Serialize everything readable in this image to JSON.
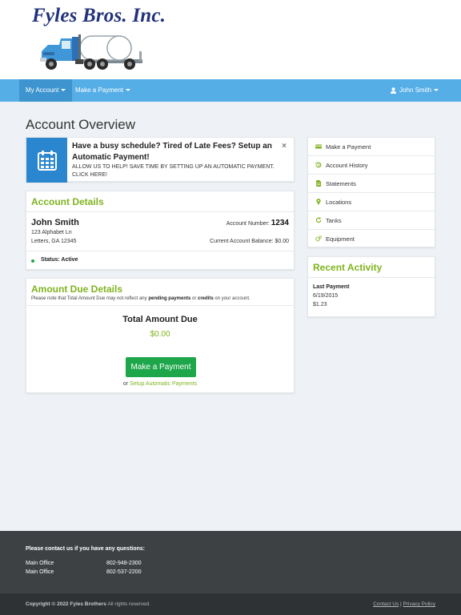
{
  "brand": {
    "name": "Fyles Bros. Inc."
  },
  "nav": {
    "my_account": "My Account",
    "make_payment": "Make a Payment",
    "user": "John Smith"
  },
  "page": {
    "title": "Account Overview"
  },
  "promo": {
    "title": "Have a busy schedule? Tired of Late Fees? Setup an Automatic Payment!",
    "body": "ALLOW US TO HELP! SAVE TIME BY SETTING UP AN AUTOMATIC PAYMENT. CLICK HERE!",
    "close": "×"
  },
  "account": {
    "title": "Account Details",
    "name": "John Smith",
    "address1": "123 Alphabet Ln",
    "address2": "Letters, GA 12345",
    "number_label": "Account Number:",
    "number": "1234",
    "balance": "Current Account Balance: $0.00",
    "status": "Status: Active"
  },
  "due": {
    "title": "Amount Due Details",
    "note_pre": "Please note that Total Amount Due may not reflect any ",
    "note_b1": "pending payments",
    "note_mid": " or ",
    "note_b2": "credits",
    "note_post": " on your account.",
    "label": "Total Amount Due",
    "amount": "$0.00",
    "button": "Make a Payment",
    "or": "or ",
    "setup_link": "Setup Automatic Payments"
  },
  "side_menu": {
    "items": [
      {
        "label": "Make a Payment",
        "icon": "credit-card-icon"
      },
      {
        "label": "Account History",
        "icon": "history-icon"
      },
      {
        "label": "Statements",
        "icon": "document-icon"
      },
      {
        "label": "Locations",
        "icon": "map-pin-icon"
      },
      {
        "label": "Tanks",
        "icon": "refresh-icon"
      },
      {
        "label": "Equipment",
        "icon": "gears-icon"
      }
    ]
  },
  "activity": {
    "title": "Recent Activity",
    "label": "Last Payment",
    "date": "6/19/2015",
    "amount": "$1.23"
  },
  "footer": {
    "heading": "Please contact us if you have any questions:",
    "rows": [
      {
        "label": "Main Office",
        "phone": "802-948-2300"
      },
      {
        "label": "Main Office",
        "phone": "802-537-2200"
      }
    ],
    "copyright_bold": "Copyright © 2022 Fyles Brothers",
    "copyright_rest": " All rights reserved.",
    "contact_link": "Contact Us",
    "separator": " | ",
    "privacy_link": "Privacy Policy"
  },
  "colors": {
    "navbar": "#55aee6",
    "accent_green": "#7fb31f",
    "button_green": "#1ea64a",
    "promo_blue": "#2a86cf",
    "footer": "#3e4143"
  }
}
